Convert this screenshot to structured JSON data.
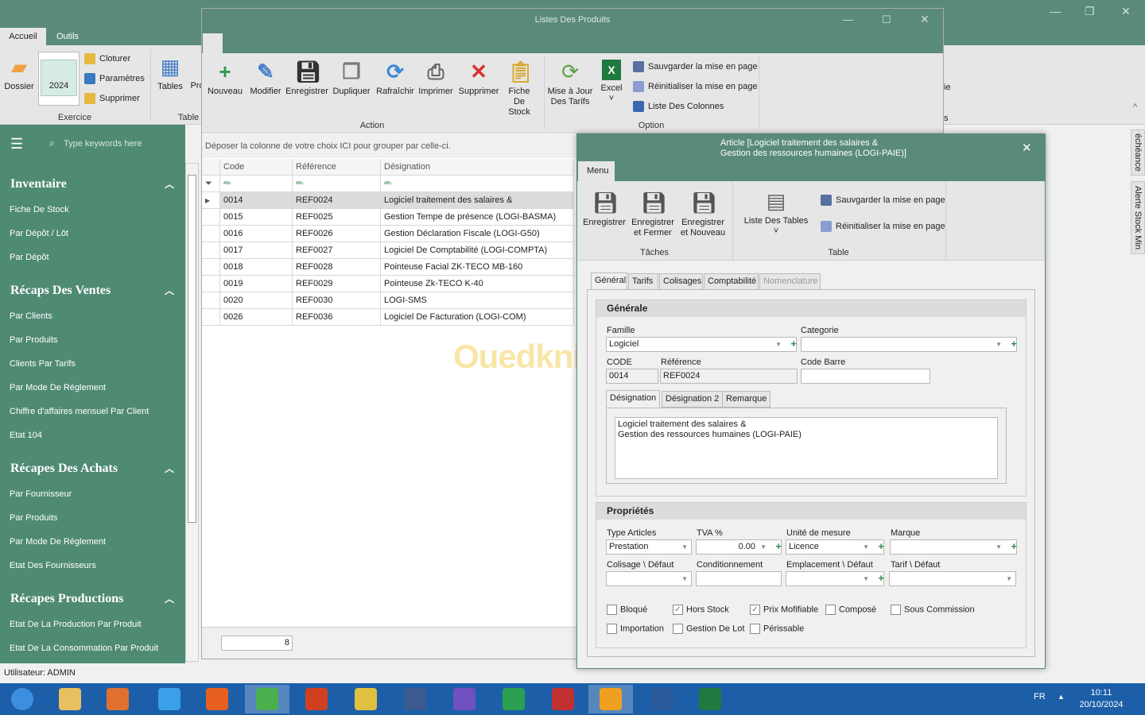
{
  "main_window": {
    "tabs": [
      "Accueil",
      "Outils"
    ],
    "active_tab": "Accueil",
    "exercice": {
      "year": "2024",
      "cloturer": "Cloturer",
      "parametres": "Paramètres",
      "supprimer": "Supprimer",
      "dossier": "Dossier",
      "group_label": "Exercice"
    },
    "table_group": {
      "tables": "Tables",
      "pro": "Pro",
      "group_label": "Table"
    },
    "partial_right": [
      "ie",
      "s"
    ]
  },
  "sidebar": {
    "search_placeholder": "Type keywords here",
    "sections": [
      {
        "title": "Inventaire",
        "items": [
          "Fiche De Stock",
          "Par Dépôt / Lôt",
          "Par Dépôt"
        ]
      },
      {
        "title": "Récaps Des Ventes",
        "items": [
          "Par Clients",
          "Par Produits",
          "Clients Par Tarifs",
          "Par Mode De Réglement",
          "Chiffre d'affaires mensuel Par Client",
          "Etat 104"
        ]
      },
      {
        "title": "Récapes Des Achats",
        "items": [
          "Par Fournisseur",
          "Par Produits",
          "Par Mode De Réglement",
          "Etat Des Fournisseurs"
        ]
      },
      {
        "title": "Récapes Productions",
        "items": [
          "Etat De La Production Par Produit",
          "Etat De La Consommation Par Produit"
        ]
      }
    ]
  },
  "status_bar": {
    "user_label": "Utilisateur:",
    "user": "ADMIN"
  },
  "right_tabs": [
    "échéance",
    "Alerte Stock Min"
  ],
  "products_window": {
    "title": "Listes Des Produits",
    "actions": [
      "Nouveau",
      "Modifier",
      "Enregistrer",
      "Dupliquer",
      "Rafraîchir",
      "Imprimer",
      "Supprimer",
      "Fiche De Stock"
    ],
    "action_group": "Action",
    "options": [
      "Mise à Jour Des Tarifs",
      "Excel"
    ],
    "option_links": [
      "Sauvgarder la mise en page",
      "Réinitialiser la mise en page",
      "Liste Des Colonnes"
    ],
    "option_group": "Option",
    "group_panel": "Déposer la colonne de votre choix ICI pour grouper par celle-ci.",
    "columns": [
      "Code",
      "Référence",
      "Désignation"
    ],
    "rows": [
      [
        "0014",
        "REF0024",
        "Logiciel traitement des salaires &"
      ],
      [
        "0015",
        "REF0025",
        "Gestion Tempe de présence (LOGI-BASMA)"
      ],
      [
        "0016",
        "REF0026",
        "Gestion Déclaration Fiscale (LOGI-G50)"
      ],
      [
        "0017",
        "REF0027",
        "Logiciel De Comptabilité (LOGI-COMPTA)"
      ],
      [
        "0018",
        "REF0028",
        "Pointeuse Facial ZK-TECO MB-160"
      ],
      [
        "0019",
        "REF0029",
        "Pointeuse Zk-TECO K-40"
      ],
      [
        "0020",
        "REF0030",
        "LOGI-SMS"
      ],
      [
        "0026",
        "REF0036",
        "Logiciel De Facturation (LOGI-COM)"
      ]
    ],
    "count": "8"
  },
  "watermark": "Ouedkniss.com",
  "article_dialog": {
    "title_line1": "Article [Logiciel traitement des salaires &",
    "title_line2": "Gestion des ressources humaines (LOGI-PAIE)]",
    "menu_tab": "Menu",
    "tasks": [
      "Enregistrer",
      "Enregistrer et Fermer",
      "Enregistrer et Nouveau"
    ],
    "tasks_group": "Tâches",
    "liste_tables": "Liste Des Tables",
    "table_links": [
      "Sauvgarder la mise en page",
      "Réinitialiser la mise en page"
    ],
    "table_group": "Table",
    "tabs": [
      "Général",
      "Tarifs",
      "Colisages",
      "Comptabilité",
      "Nomenclature"
    ],
    "generale": {
      "title": "Générale",
      "famille_label": "Famille",
      "famille": "Logiciel",
      "categorie_label": "Categorie",
      "categorie": "",
      "code_label": "CODE",
      "code": "0014",
      "reference_label": "Référence",
      "reference": "REF0024",
      "code_barre_label": "Code Barre",
      "code_barre": "",
      "desc_tabs": [
        "Désignation",
        "Désignation 2",
        "Remarque"
      ],
      "designation": "Logiciel traitement des salaires &\nGestion des ressources humaines (LOGI-PAIE)"
    },
    "proprietes": {
      "title": "Propriétés",
      "type_articles_label": "Type Articles",
      "type_articles": "Prestation",
      "tva_label": "TVA %",
      "tva": "0.00",
      "unite_label": "Unité de mesure",
      "unite": "Licence",
      "marque_label": "Marque",
      "marque": "",
      "colisage_label": "Colisage \\ Défaut",
      "conditionnement_label": "Conditionnement",
      "emplacement_label": "Emplacement \\ Défaut",
      "tarif_label": "Tarif \\ Défaut",
      "checkboxes": [
        {
          "label": "Bloqué",
          "checked": false
        },
        {
          "label": "Hors Stock",
          "checked": true
        },
        {
          "label": "Prix Mofifiable",
          "checked": true
        },
        {
          "label": "Composé",
          "checked": false
        },
        {
          "label": "Sous Commission",
          "checked": false
        },
        {
          "label": "Importation",
          "checked": false
        },
        {
          "label": "Gestion De Lot",
          "checked": false
        },
        {
          "label": "Périssable",
          "checked": false
        }
      ]
    }
  },
  "taskbar": {
    "lang": "FR",
    "time": "10:11",
    "date": "20/10/2024",
    "apps": [
      "start",
      "file-explorer",
      "media-player",
      "internet-explorer",
      "firefox",
      "chrome",
      "ccleaner",
      "tools",
      "g50",
      "visual-studio",
      "chart-app",
      "team-app",
      "active-app",
      "screenshot",
      "excel"
    ]
  },
  "colors": {
    "title_green": "#5a8b79",
    "sidebar_green": "#4f8a73",
    "taskbar_blue": "#1c5fa8"
  }
}
